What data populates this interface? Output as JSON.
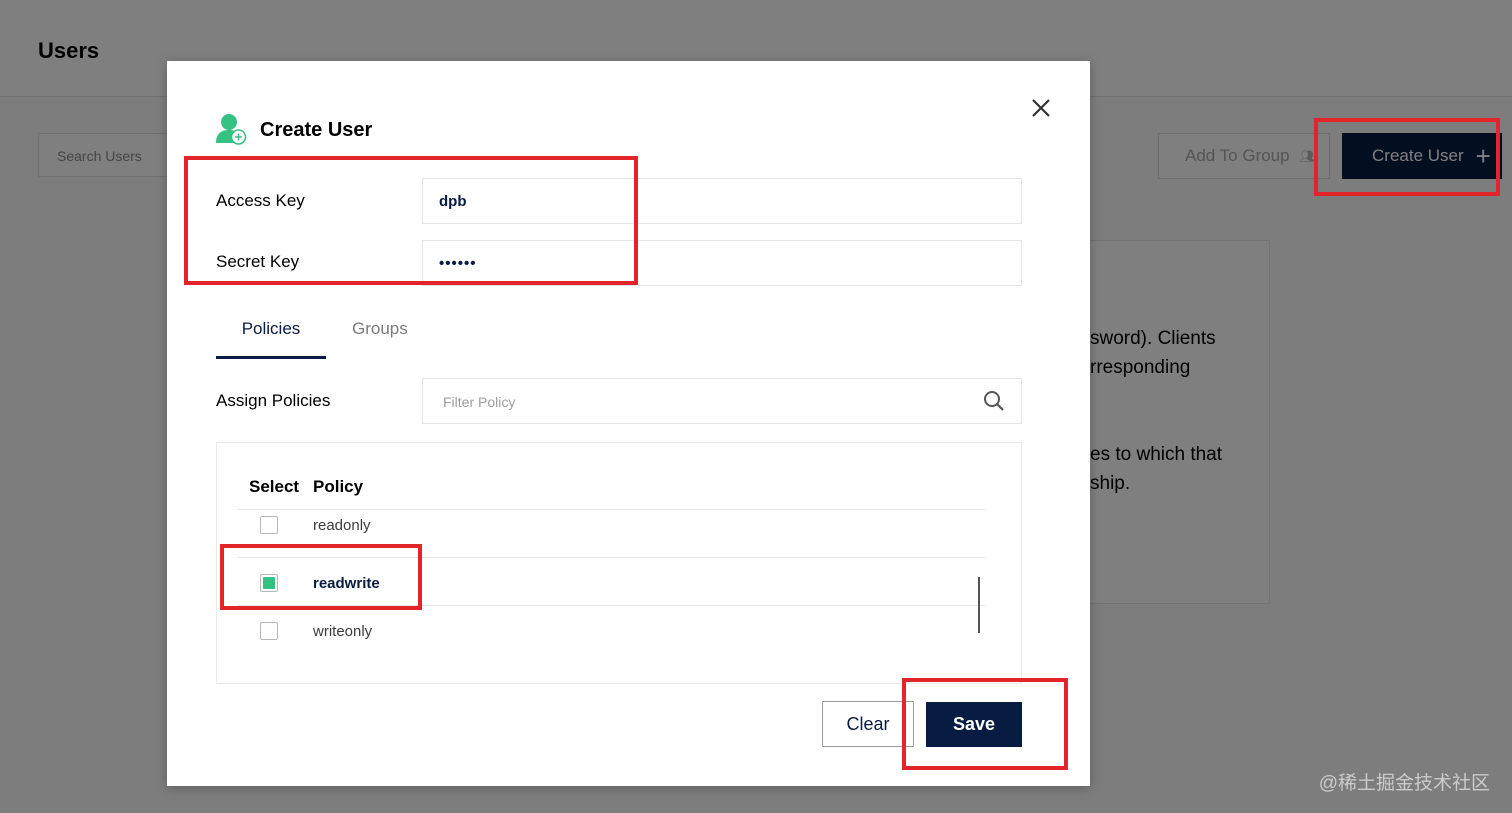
{
  "page": {
    "title": "Users",
    "search_placeholder": "Search Users",
    "add_to_group_label": "Add To Group",
    "create_user_label": "Create User",
    "help_lines": [
      "sword). Clients",
      "rresponding",
      "es to which that",
      "ship."
    ]
  },
  "modal": {
    "title": "Create User",
    "access_key_label": "Access Key",
    "access_key_value": "dpb",
    "secret_key_label": "Secret Key",
    "secret_key_value": "••••••",
    "tabs": [
      {
        "label": "Policies",
        "active": true
      },
      {
        "label": "Groups",
        "active": false
      }
    ],
    "assign_policies_label": "Assign Policies",
    "filter_placeholder": "Filter Policy",
    "table": {
      "headers": [
        "Select",
        "Policy"
      ],
      "rows": [
        {
          "policy": "readonly",
          "selected": false
        },
        {
          "policy": "readwrite",
          "selected": true
        },
        {
          "policy": "writeonly",
          "selected": false
        }
      ]
    },
    "clear_label": "Clear",
    "save_label": "Save"
  },
  "watermark": "@稀土掘金技术社区",
  "colors": {
    "primary": "#081c42",
    "checkbox_selected": "#34c181",
    "highlight": "#e3242b",
    "user_icon": "#34c181"
  }
}
